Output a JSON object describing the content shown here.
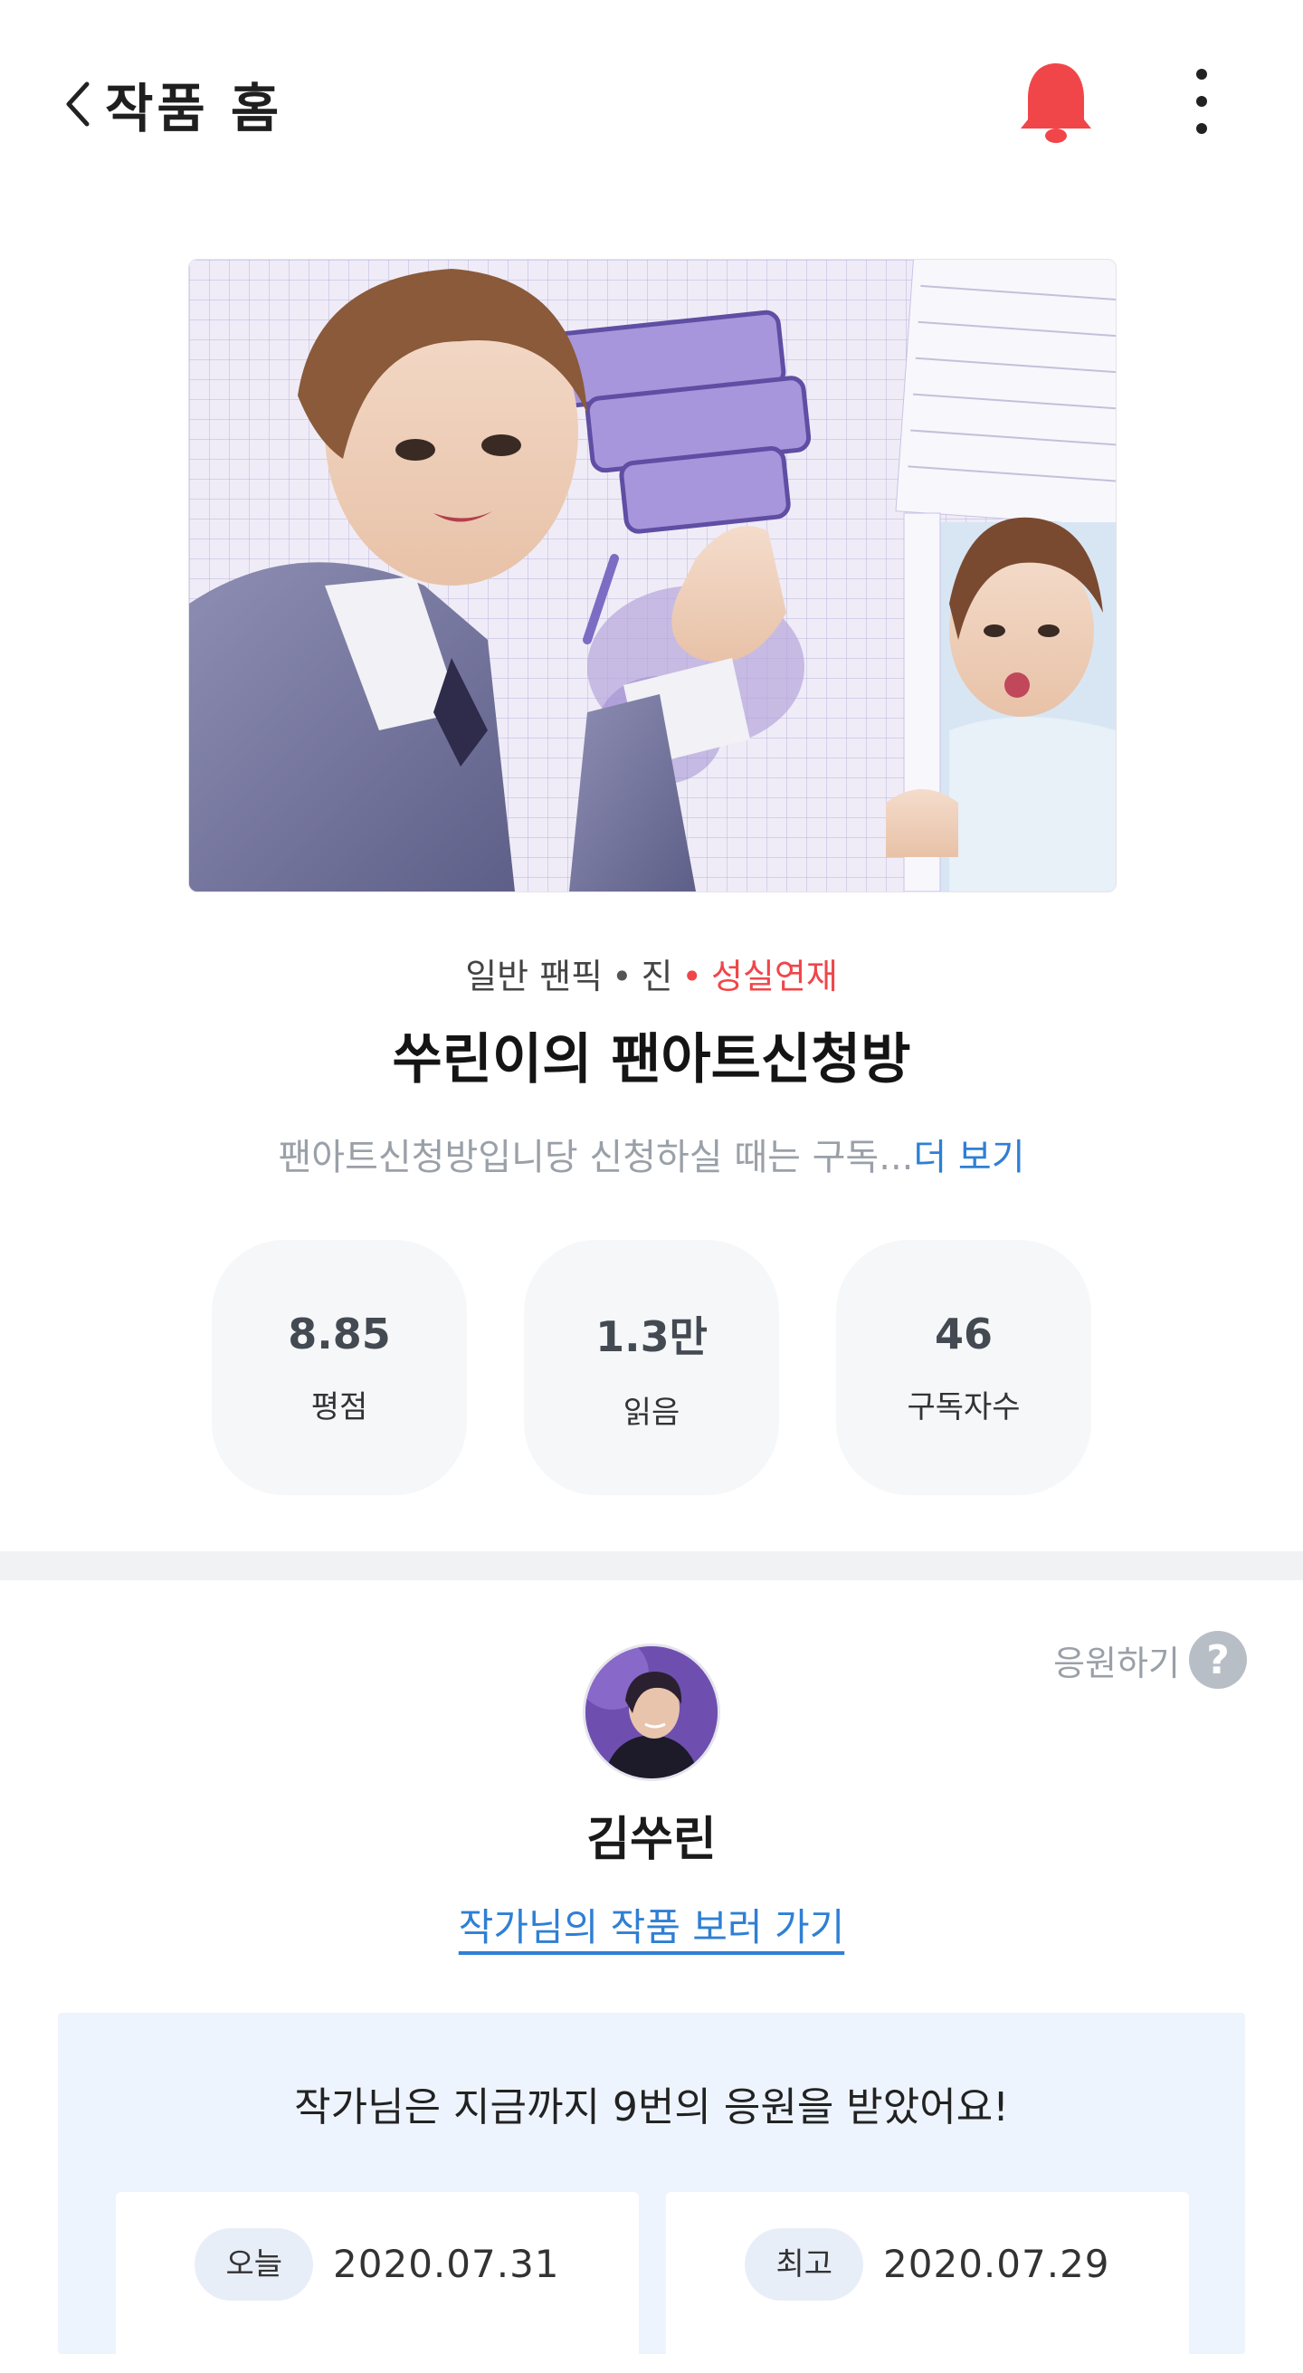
{
  "header": {
    "title": "작품 홈",
    "back_icon": "chevron-left-icon",
    "bell_icon": "bell-icon",
    "bell_color": "#f0464a",
    "more_icon": "more-vertical-icon"
  },
  "work": {
    "meta": {
      "genre": "일반 팬픽",
      "character": "진",
      "status": "성실연재"
    },
    "title": "쑤린이의 팬아트신청방",
    "description": "팬아트신청방입니당 신청하실 때는 구독...",
    "more_label": "더 보기"
  },
  "stats": [
    {
      "value": "8.85",
      "label": "평점"
    },
    {
      "value": "1.3만",
      "label": "읽음"
    },
    {
      "value": "46",
      "label": "구독자수"
    }
  ],
  "author": {
    "cheer_help_label": "응원하기",
    "help_icon": "question-icon",
    "name": "김쑤린",
    "works_link": "작가님의 작품 보러 가기"
  },
  "cheer": {
    "summary": "작가님은 지금까지 9번의 응원을 받았어요!",
    "today_label": "오늘",
    "today_date": "2020.07.31",
    "latest_label": "최고",
    "latest_date": "2020.07.29"
  },
  "colors": {
    "accent_red": "#f0464a",
    "link_blue": "#2f7fd4",
    "cheer_bg": "#eef4fd"
  }
}
